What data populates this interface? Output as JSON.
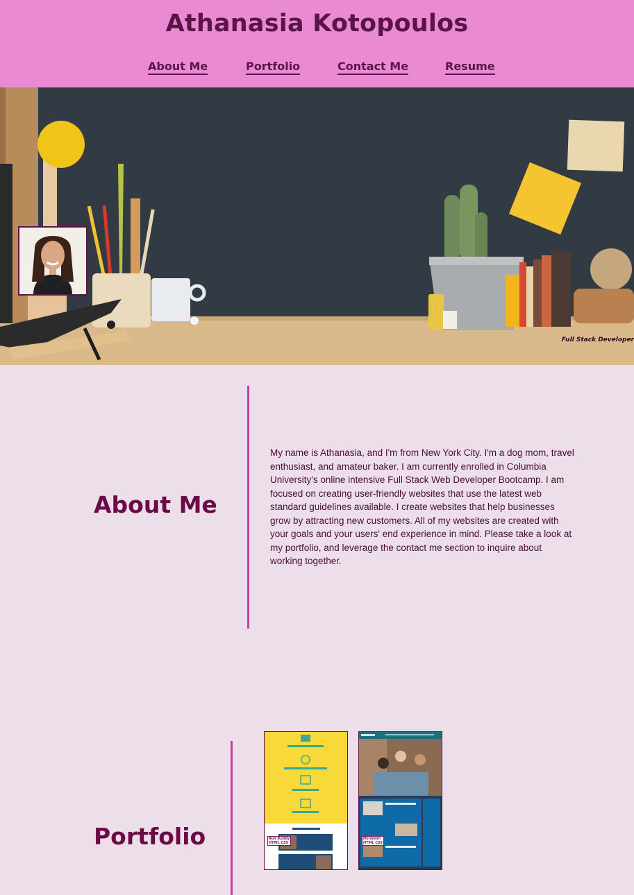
{
  "header": {
    "title": "Athanasia Kotopoulos",
    "nav": [
      "About Me",
      "Portfolio",
      "Contact Me",
      "Resume"
    ]
  },
  "hero": {
    "caption": "Full Stack Developer"
  },
  "about": {
    "heading": "About Me",
    "text": "My name is Athanasia, and I'm from New York City. I'm a dog mom, travel enthusiast, and amateur baker. I am currently enrolled in Columbia University's online intensive Full Stack Web Developer Bootcamp. I am focused on creating user-friendly websites that use the latest web standard guidelines available. I create websites that help businesses grow by attracting new customers. All of my websites are created with your goals and your users' end experience in mind. Please take a look at my portfolio, and leverage the contact me section to inquire about working together."
  },
  "portfolio": {
    "heading": "Portfolio",
    "projects": [
      {
        "name": "Run Buddy",
        "tech": "HTML CSS"
      },
      {
        "name": "Horiseon",
        "tech": "HTML CSS"
      }
    ]
  },
  "colors": {
    "header_bg": "#e98ad3",
    "page_bg": "#ecdfea",
    "accent": "#c63fa8",
    "heading": "#6b0a46"
  }
}
